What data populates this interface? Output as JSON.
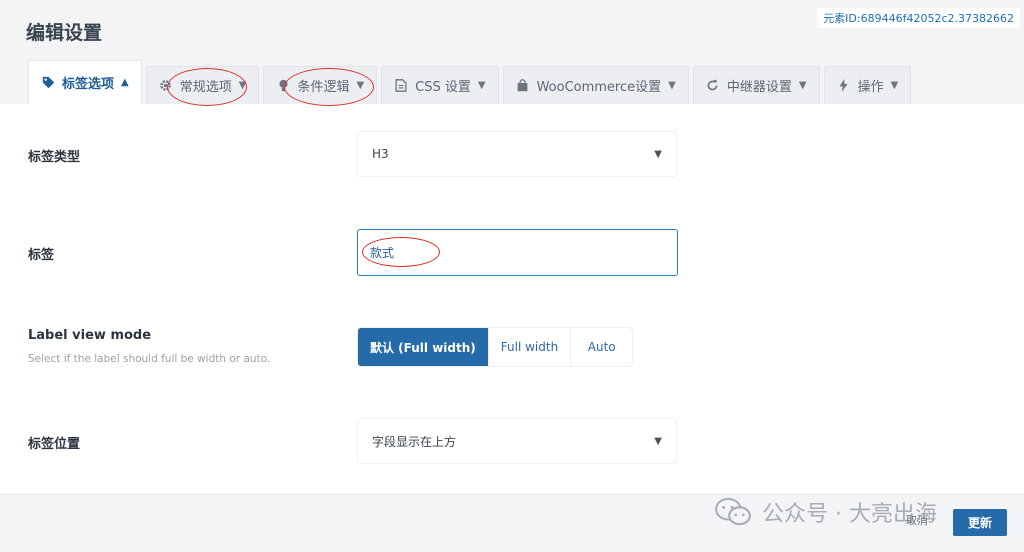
{
  "modal": {
    "title": "编辑设置",
    "element_id": "元素ID:689446f42052c2.37382662"
  },
  "tabs": [
    {
      "label": "标签选项",
      "icon": "tag-icon"
    },
    {
      "label": "常规选项",
      "icon": "gear-icon"
    },
    {
      "label": "条件逻辑",
      "icon": "lightbulb-icon"
    },
    {
      "label": "CSS 设置",
      "icon": "document-icon"
    },
    {
      "label": "WooCommerce设置",
      "icon": "shopping-bag-icon"
    },
    {
      "label": "中继器设置",
      "icon": "refresh-icon"
    },
    {
      "label": "操作",
      "icon": "bolt-icon"
    }
  ],
  "fields": {
    "tag_type": {
      "label": "标签类型",
      "value": "H3"
    },
    "label": {
      "label": "标签",
      "value": "款式"
    },
    "view_mode": {
      "label": "Label view mode",
      "description": "Select if the label should full be width or auto.",
      "options": [
        "默认 (Full width)",
        "Full width",
        "Auto"
      ],
      "selected": 0
    },
    "label_position": {
      "label": "标签位置",
      "value": "字段显示在上方"
    }
  },
  "footer": {
    "cancel_label": "取消",
    "update_label": "更新"
  },
  "watermark": {
    "text": "公众号 · 大亮出海"
  },
  "colors": {
    "accent": "#256aa9",
    "annotation": "#d4312c",
    "header_bg": "#f3f4f6"
  }
}
